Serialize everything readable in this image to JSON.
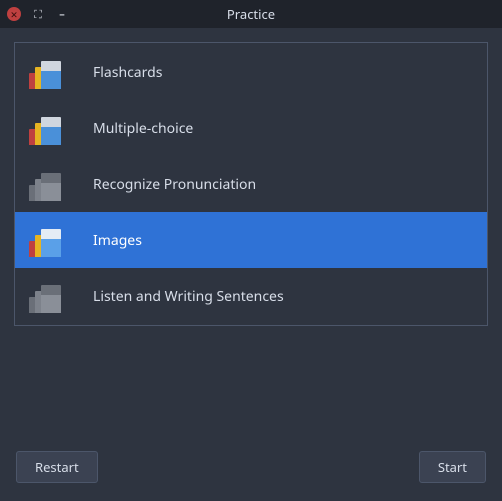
{
  "window": {
    "title": "Practice"
  },
  "modes": [
    {
      "id": "flashcards",
      "label": "Flashcards",
      "icon": "cards-color",
      "selected": false
    },
    {
      "id": "multiple",
      "label": "Multiple-choice",
      "icon": "cards-color",
      "selected": false
    },
    {
      "id": "pronun",
      "label": "Recognize Pronunciation",
      "icon": "cards-gray",
      "selected": false
    },
    {
      "id": "images",
      "label": "Images",
      "icon": "cards-sel",
      "selected": true
    },
    {
      "id": "listenwrite",
      "label": "Listen and Writing Sentences",
      "icon": "cards-gray",
      "selected": false
    }
  ],
  "buttons": {
    "restart": "Restart",
    "start": "Start"
  }
}
